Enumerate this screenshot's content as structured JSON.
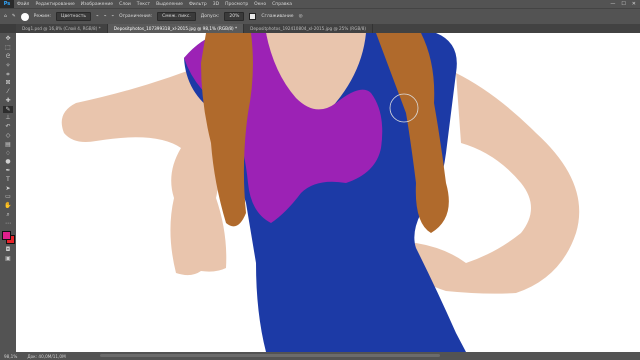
{
  "menu": {
    "logo": "Ps",
    "items": [
      "Файл",
      "Редактирование",
      "Изображение",
      "Слои",
      "Текст",
      "Выделение",
      "Фильтр",
      "3D",
      "Просмотр",
      "Окно",
      "Справка"
    ],
    "window_controls": [
      "—",
      "☐",
      "✕"
    ]
  },
  "options": {
    "mode_label": "Режим:",
    "mode_value": "Цветность",
    "limits_label": "Ограничения:",
    "limits_value": "Смеж. пикс.",
    "tolerance_label": "Допуск:",
    "tolerance_value": "20%",
    "antialias_label": "Сглаживание"
  },
  "tabs": [
    {
      "label": "Dog1.psd @ 16,8% (Слой 4, RGB/8) *",
      "active": false
    },
    {
      "label": "Depositphotos_107399318_xl-2015.jpg @ 98,1% (RGB/8) *",
      "active": true
    },
    {
      "label": "Depositphotos_192410804_xl-2015.jpg @ 25% (RGB/8)",
      "active": false
    }
  ],
  "status": {
    "zoom": "98,1%",
    "doc": "Док: 40,0M/11,0M"
  },
  "colors": {
    "foreground": "#e01f8c",
    "background": "#e8232a",
    "dress": "#1c3aa6",
    "recolored": "#9c22b5",
    "hair": "#b06a2c",
    "skin": "#e9c5ad"
  }
}
